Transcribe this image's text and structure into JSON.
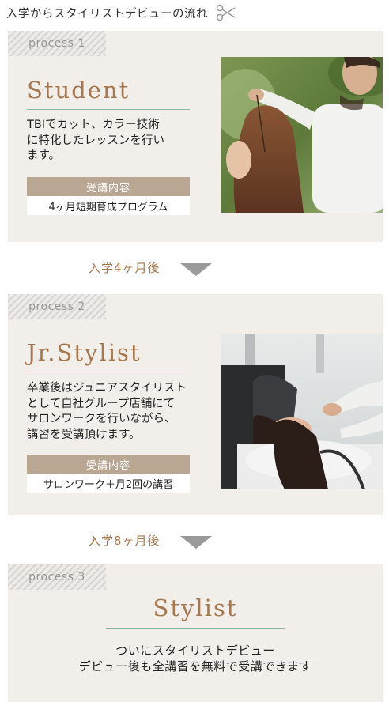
{
  "header": {
    "title": "入学からスタイリストデビューの流れ",
    "icon": "scissors-icon"
  },
  "colors": {
    "card_bg": "#f2eeea",
    "accent": "#a6784f",
    "label_bg": "#b9a693",
    "rule": "#8fb4a8",
    "arrow": "#9a9a9a"
  },
  "process1": {
    "tag": "process 1",
    "title": "Student",
    "desc": [
      "TBIでカット、カラー技術",
      "に特化したレッスンを行い",
      "ます。"
    ],
    "label": "受講内容",
    "value": "4ヶ月短期育成プログラム"
  },
  "arrow1": {
    "text": "入学4ヶ月後"
  },
  "process2": {
    "tag": "process 2",
    "title": "Jr.Stylist",
    "desc": [
      "卒業後はジュニアスタイリスト",
      "として自社グループ店舗にて",
      "サロンワークを行いながら、",
      "講習を受講頂けます。"
    ],
    "label": "受講内容",
    "value": "サロンワーク＋月2回の講習"
  },
  "arrow2": {
    "text": "入学8ヶ月後"
  },
  "process3": {
    "tag": "process 3",
    "title": "Stylist",
    "lines": [
      "ついにスタイリストデビュー",
      "デビュー後も全講習を無料で受講できます"
    ]
  }
}
